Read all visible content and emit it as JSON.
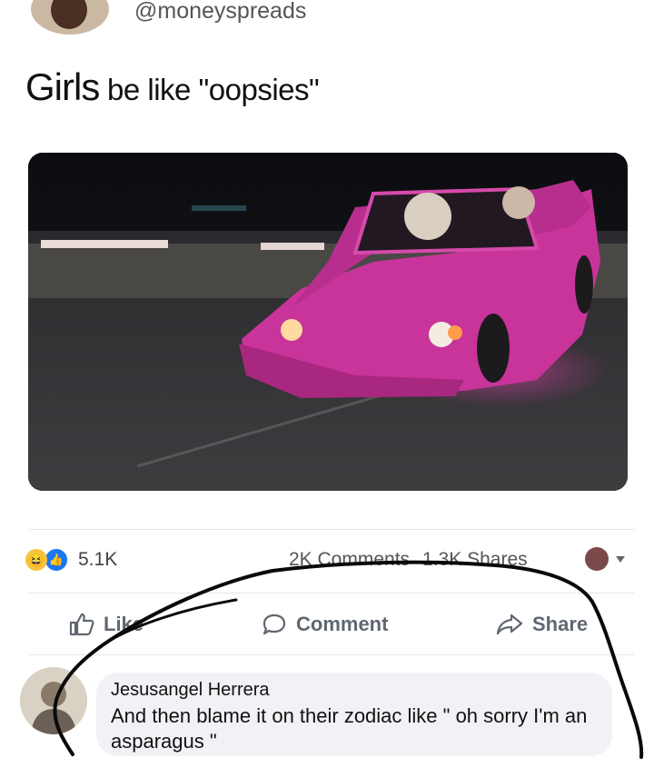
{
  "post": {
    "handle": "@moneyspreads",
    "text_lead": "Girls",
    "text_rest": " be like \"oopsies\""
  },
  "photo": {
    "icon": "crashed-pink-convertible-image"
  },
  "engagement": {
    "reaction_count": "5.1K",
    "comments": "2K Comments",
    "shares": "1.3K Shares"
  },
  "actions": {
    "like": "Like",
    "comment": "Comment",
    "share": "Share"
  },
  "comment": {
    "author": "Jesusangel Herrera",
    "text": "And then blame it on their zodiac like \" oh sorry I'm an asparagus \""
  },
  "colors": {
    "like_blue": "#1877f2",
    "haha_yellow": "#f7c33d",
    "car_pink": "#d0359f",
    "bubble_grey": "#f0f2f5"
  }
}
